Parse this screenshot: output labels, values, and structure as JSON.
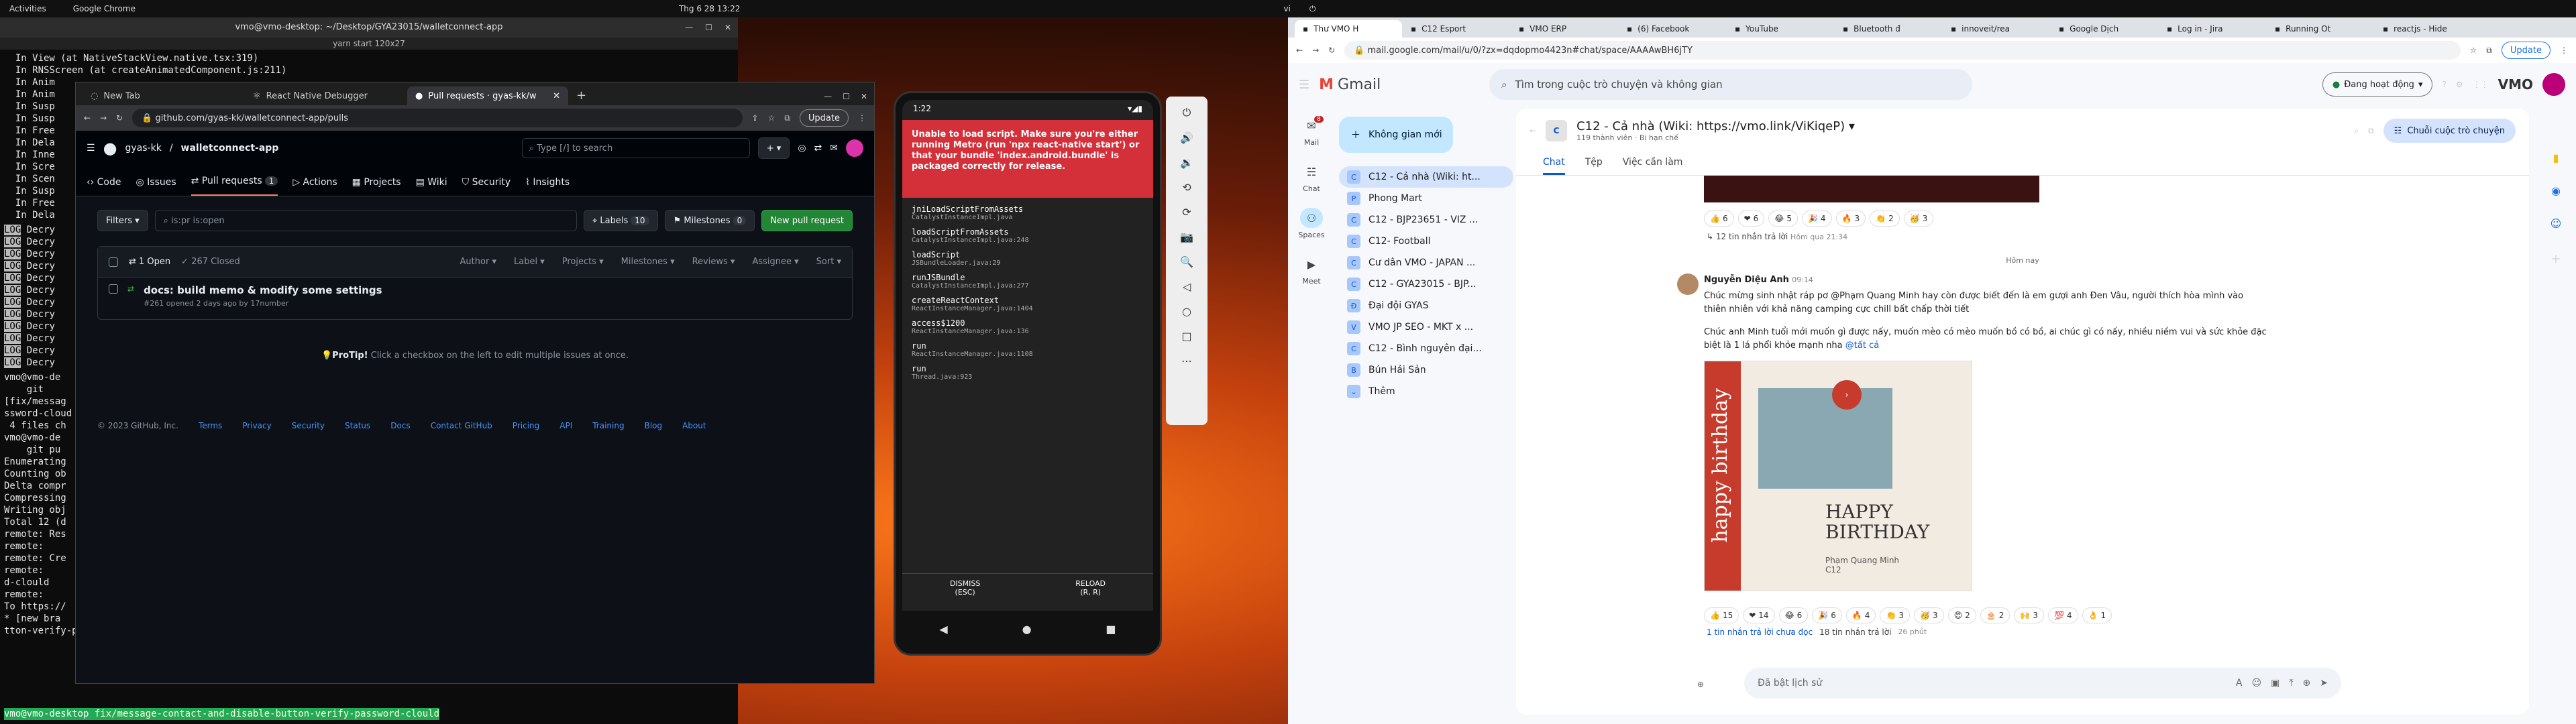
{
  "topbar": {
    "activities": "Activities",
    "app": "Google Chrome",
    "datetime": "Thg 6 28  13:22",
    "lang": "vi"
  },
  "terminal": {
    "title": "vmo@vmo-desktop: ~/Desktop/GYA23015/walletconnect-app",
    "subtitle": "yarn start 120x27",
    "lines": [
      "  In View (at NativeStackView.native.tsx:319)",
      "  In RNSScreen (at createAnimatedComponent.js:211)",
      "  In Anim",
      "  In Anim",
      "  In Susp",
      "  In Susp",
      "  In Free",
      "  In Dela",
      "  In Inne",
      "  In Scre",
      "  In Scen",
      "  In Susp",
      "  In Free",
      "  In Dela"
    ],
    "loglines": [
      "Decry",
      "Decry",
      "Decry",
      "Decry",
      "Decry",
      "Decry",
      "Decry",
      "Decry",
      "Decry",
      "Decry",
      "Decry",
      "Decry"
    ],
    "bottom": [
      "vmo@vmo-de",
      "    git",
      "[fix/messag",
      "ssword-cloud",
      " 4 files ch",
      "vmo@vmo-de",
      "    git pu",
      "Enumerating",
      "Counting ob",
      "Delta compr",
      "Compressing",
      "Writing obj",
      "Total 12 (d",
      "remote: Res",
      "remote:",
      "remote: Cre",
      "remote:",
      "d-clould",
      "remote:",
      "To https://",
      "* [new bra",
      "tton-verify-password-clould"
    ],
    "prompt": "vmo@vmo-desktop",
    "branch": "fix/message-contact-and-disable-button-verify-password-clould"
  },
  "chrome_left": {
    "tabs": [
      "New Tab",
      "React Native Debugger",
      "Pull requests · gyas-kk/w"
    ],
    "url": "github.com/gyas-kk/walletconnect-app/pulls",
    "update": "Update"
  },
  "github": {
    "owner": "gyas-kk",
    "repo": "walletconnect-app",
    "search": "Type [/] to search",
    "nav": [
      {
        "label": "Code"
      },
      {
        "label": "Issues"
      },
      {
        "label": "Pull requests",
        "count": "1"
      },
      {
        "label": "Actions"
      },
      {
        "label": "Projects"
      },
      {
        "label": "Wiki"
      },
      {
        "label": "Security"
      },
      {
        "label": "Insights"
      }
    ],
    "filters": "Filters",
    "query": "is:pr is:open",
    "labels": "Labels",
    "labels_count": "10",
    "milestones": "Milestones",
    "milestones_count": "0",
    "new_pr": "New pull request",
    "open": "1 Open",
    "closed": "267 Closed",
    "cols": [
      "Author",
      "Label",
      "Projects",
      "Milestones",
      "Reviews",
      "Assignee",
      "Sort"
    ],
    "pr_title": "docs: build memo & modify some settings",
    "pr_meta": "#261 opened 2 days ago by 17number",
    "protip_b": "ProTip!",
    "protip": " Click a checkbox on the left to edit multiple issues at once.",
    "footer": [
      "© 2023 GitHub, Inc.",
      "Terms",
      "Privacy",
      "Security",
      "Status",
      "Docs",
      "Contact GitHub",
      "Pricing",
      "API",
      "Training",
      "Blog",
      "About"
    ]
  },
  "emulator": {
    "time": "1:22",
    "error": "Unable to load script. Make sure you're either running Metro (run 'npx react-native start') or that your bundle 'index.android.bundle' is packaged correctly for release.",
    "frames": [
      {
        "f": "jniLoadScriptFromAssets",
        "s": "CatalystInstanceImpl.java"
      },
      {
        "f": "loadScriptFromAssets",
        "s": "CatalystInstanceImpl.java:248"
      },
      {
        "f": "loadScript",
        "s": "JSBundleLoader.java:29"
      },
      {
        "f": "runJSBundle",
        "s": "CatalystInstanceImpl.java:277"
      },
      {
        "f": "createReactContext",
        "s": "ReactInstanceManager.java:1404"
      },
      {
        "f": "access$1200",
        "s": "ReactInstanceManager.java:136"
      },
      {
        "f": "run",
        "s": "ReactInstanceManager.java:1108"
      },
      {
        "f": "run",
        "s": "Thread.java:923"
      }
    ],
    "dismiss": "DISMISS",
    "dismiss_k": "(ESC)",
    "reload": "RELOAD",
    "reload_k": "(R, R)"
  },
  "chrome_right": {
    "tabs": [
      "Thư VMO H",
      "C12 Esport",
      "VMO ERP",
      "(6) Facebook",
      "YouTube",
      "Bluetooth đ",
      "innoveit/rea",
      "Google Dịch",
      "Log in - Jira",
      "Running Ot",
      "reactjs - Hide"
    ],
    "url": "mail.google.com/mail/u/0/?zx=dqdopmo4423n#chat/space/AAAAwBH6jTY",
    "update": "Update"
  },
  "gmail": {
    "brand": "Gmail",
    "search": "Tìm trong cuộc trò chuyện và không gian",
    "status": "Đang hoạt động",
    "vmo": "VMO",
    "left": [
      {
        "label": "Mail",
        "badge": "8"
      },
      {
        "label": "Chat"
      },
      {
        "label": "Spaces"
      },
      {
        "label": "Meet"
      }
    ],
    "new": "Không gian mới",
    "spaces": [
      "C12 - Cả nhà (Wiki: ht...",
      "Phong Mart",
      "C12 - BJP23651 - VIZ ...",
      "C12- Football",
      "Cư dân VMO - JAPAN ...",
      "C12 - GYA23015 - BJP...",
      "Đại đội GYAS",
      "VMO JP SEO - MKT x ...",
      "C12 - Bình nguyên đại...",
      "Bún Hải Sản",
      "Thêm"
    ],
    "space_title": "C12 - Cả nhà (Wiki: https://vmo.link/ViKiqeP)",
    "space_sub": "119 thành viên · Bị hạn chế",
    "thread_btn": "Chuỗi cuộc trò chuyện",
    "tabs": [
      "Chat",
      "Tệp",
      "Việc cần làm"
    ],
    "r1": [
      "6",
      "6",
      "5",
      "4",
      "3",
      "2",
      "3"
    ],
    "r1_replies": "12 tin nhắn trả lời",
    "r1_time": "Hôm qua 21:34",
    "today": "Hôm nay",
    "sender": "Nguyễn Diệu Anh",
    "sent": "09:14",
    "m1": "Chúc mừng sinh nhật ráp pơ @Phạm Quang Minh hay còn được biết đến là em gượi anh Đen Vâu, người thích hòa mình vào thiên nhiên với khả năng camping cực chill bất chấp thời tiết",
    "m2": "Chúc anh Minh tuổi mới muốn gì được nấy, muốn mèo có mèo muốn bồ có bồ, ai chúc gì có nấy, nhiều niềm vui và sức khỏe đặc biệt là 1 lá phổi khỏe mạnh nha",
    "mention": "@tất cả",
    "card": {
      "hbd1": "HAPPY",
      "hbd2": "BIRTHDAY",
      "name": "Phạm Quang Minh",
      "team": "C12",
      "side": "happy birthday"
    },
    "r2": [
      "15",
      "14",
      "6",
      "6",
      "4",
      "3",
      "3",
      "2",
      "2",
      "3",
      "4",
      "1"
    ],
    "unread": "1 tin nhắn trả lời chưa đọc",
    "replies2": "18 tin nhắn trả lời",
    "ago": "26 phút",
    "composer": "Đã bật lịch sử"
  }
}
